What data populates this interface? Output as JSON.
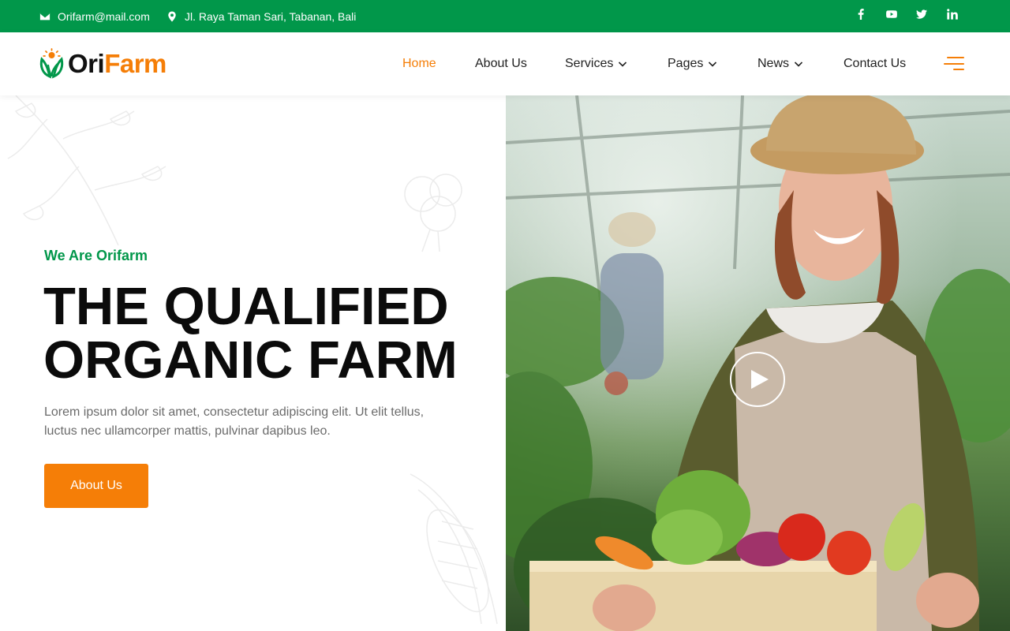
{
  "topbar": {
    "email": "Orifarm@mail.com",
    "address": "Jl. Raya Taman Sari, Tabanan, Bali",
    "social": [
      "facebook-icon",
      "youtube-icon",
      "twitter-icon",
      "linkedin-icon"
    ],
    "bg_color": "#01974a"
  },
  "header": {
    "logo_part1": "Ori",
    "logo_part2": "Farm",
    "nav": [
      {
        "label": "Home",
        "active": true
      },
      {
        "label": "About Us",
        "active": false
      },
      {
        "label": "Services",
        "active": false,
        "dropdown": true
      },
      {
        "label": "Pages",
        "active": false,
        "dropdown": true
      },
      {
        "label": "News",
        "active": false,
        "dropdown": true
      },
      {
        "label": "Contact Us",
        "active": false
      }
    ],
    "menu_icon": "hamburger-menu-icon",
    "accent_color": "#f57e07"
  },
  "hero": {
    "eyebrow": "We Are Orifarm",
    "headline_line1": "THE QUALIFIED",
    "headline_line2": "ORGANIC FARM",
    "lead": "Lorem ipsum dolor sit amet, consectetur adipiscing elit. Ut elit tellus, luctus nec ullamcorper mattis, pulvinar dapibus leo.",
    "button_label": "About Us",
    "video_icon": "play-icon"
  }
}
